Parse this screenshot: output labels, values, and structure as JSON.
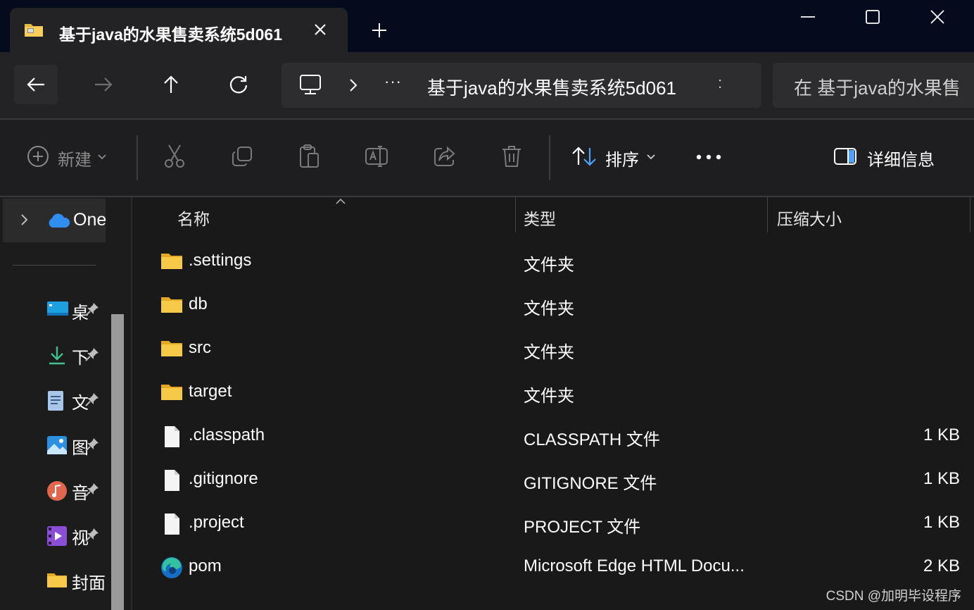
{
  "tab": {
    "title": "基于java的水果售卖系统5d061",
    "icon": "zip-folder-icon"
  },
  "window": {
    "buttons": [
      "minimize-icon",
      "maximize-icon",
      "close-icon"
    ]
  },
  "address": {
    "more": "···",
    "path": "基于java的水果售卖系统5d061",
    "separator": ":"
  },
  "search": {
    "placeholder": "在 基于java的水果售"
  },
  "toolbar": {
    "new_label": "新建",
    "sort_label": "排序",
    "more_label": "···",
    "details_label": "详细信息"
  },
  "sidebar": {
    "onedrive_label": "One",
    "items": [
      {
        "label": "桌",
        "icon": "desktop-icon"
      },
      {
        "label": "下",
        "icon": "downloads-icon"
      },
      {
        "label": "文",
        "icon": "documents-icon"
      },
      {
        "label": "图",
        "icon": "pictures-icon"
      },
      {
        "label": "音",
        "icon": "music-icon"
      },
      {
        "label": "视",
        "icon": "videos-icon"
      },
      {
        "label": "封面",
        "icon": "folder-icon"
      }
    ]
  },
  "columns": {
    "name": "名称",
    "type": "类型",
    "size": "压缩大小"
  },
  "files": [
    {
      "name": ".settings",
      "type": "文件夹",
      "size": "",
      "icon": "folder-icon"
    },
    {
      "name": "db",
      "type": "文件夹",
      "size": "",
      "icon": "folder-icon"
    },
    {
      "name": "src",
      "type": "文件夹",
      "size": "",
      "icon": "folder-icon"
    },
    {
      "name": "target",
      "type": "文件夹",
      "size": "",
      "icon": "folder-icon"
    },
    {
      "name": ".classpath",
      "type": "CLASSPATH 文件",
      "size": "1 KB",
      "icon": "file-icon"
    },
    {
      "name": ".gitignore",
      "type": "GITIGNORE 文件",
      "size": "1 KB",
      "icon": "file-icon"
    },
    {
      "name": ".project",
      "type": "PROJECT 文件",
      "size": "1 KB",
      "icon": "file-icon"
    },
    {
      "name": "pom",
      "type": "Microsoft Edge HTML Docu...",
      "size": "2 KB",
      "icon": "edge-icon"
    }
  ],
  "watermark": "CSDN @加明毕设程序",
  "colors": {
    "titlebar": "#030b1c",
    "nav": "#232326",
    "toolbar": "#1e1e20",
    "content": "#191919",
    "folder": "#f5c542",
    "accent": "#4ea1f3"
  }
}
